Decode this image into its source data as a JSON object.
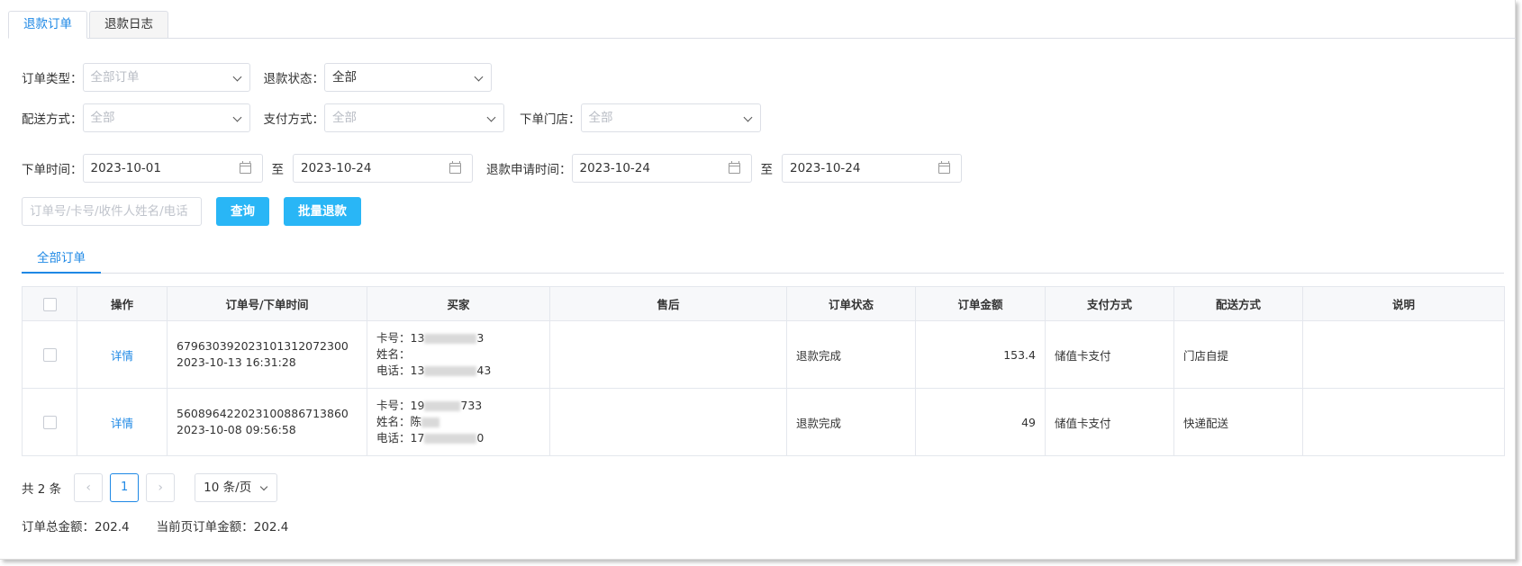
{
  "tabs": [
    "退款订单",
    "退款日志"
  ],
  "filters": {
    "order_type": {
      "label": "订单类型：",
      "value": "全部订单",
      "placeholder": true
    },
    "refund_status": {
      "label": "退款状态：",
      "value": "全部",
      "placeholder": false
    },
    "delivery": {
      "label": "配送方式：",
      "value": "全部",
      "placeholder": true
    },
    "payment": {
      "label": "支付方式：",
      "value": "全部",
      "placeholder": true
    },
    "store": {
      "label": "下单门店：",
      "value": "全部",
      "placeholder": true
    },
    "order_time": {
      "label": "下单时间：",
      "start": "2023-10-01",
      "sep": "至",
      "end": "2023-10-24"
    },
    "refund_time": {
      "label": "退款申请时间：",
      "start": "2023-10-24",
      "sep": "至",
      "end": "2023-10-24"
    },
    "search_placeholder": "订单号/卡号/收件人姓名/电话",
    "query_button": "查询",
    "batch_refund_button": "批量退款"
  },
  "subtab": "全部订单",
  "table": {
    "columns": [
      "",
      "操作",
      "订单号/下单时间",
      "买家",
      "售后",
      "订单状态",
      "订单金额",
      "支付方式",
      "配送方式",
      "说明"
    ],
    "rows": [
      {
        "action": "详情",
        "order_no": "679630392023101312072300",
        "order_time": "2023-10-13 16:31:28",
        "card_prefix": "卡号：13",
        "card_suffix": "3",
        "name_prefix": "姓名：",
        "name_suffix": "",
        "phone_prefix": "电话：13",
        "phone_suffix": "43",
        "after_sale": "",
        "status": "退款完成",
        "amount": "153.4",
        "payment": "储值卡支付",
        "delivery": "门店自提",
        "note": ""
      },
      {
        "action": "详情",
        "order_no": "560896422023100886713860",
        "order_time": "2023-10-08 09:56:58",
        "card_prefix": "卡号：19",
        "card_suffix": "733",
        "name_prefix": "姓名：陈",
        "name_suffix": "",
        "phone_prefix": "电话：17",
        "phone_suffix": "0",
        "after_sale": "",
        "status": "退款完成",
        "amount": "49",
        "payment": "储值卡支付",
        "delivery": "快递配送",
        "note": ""
      }
    ]
  },
  "pagination": {
    "total": "共 2 条",
    "prev": "‹",
    "current": "1",
    "next": "›",
    "page_size": "10 条/页"
  },
  "summary": {
    "total_amount": "订单总金额：202.4",
    "page_amount": "当前页订单金额：202.4"
  }
}
